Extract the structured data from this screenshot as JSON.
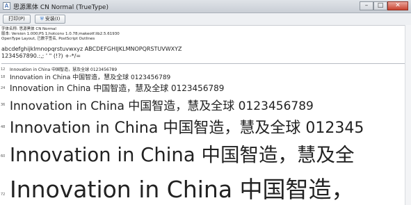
{
  "window": {
    "title": "思源黑体 CN Normal (TrueType)",
    "controls": {
      "minimize": "–",
      "maximize": "□",
      "close": "✕"
    }
  },
  "toolbar": {
    "print_label": "打印(P)",
    "install_label": "安装(I)"
  },
  "font_info": {
    "name_line": "字体名称: 思源黑体 CN Normal",
    "version_line": "版本: Version 1.000;PS 1;hotconv 1.0.78;makeotf.lib2.5.61930",
    "type_line": "OpenType Layout, 已数字签名, PostScript Outlines"
  },
  "charset": {
    "lower_upper": "abcdefghijklmnopqrstuvwxyz ABCDEFGHIJKLMNOPQRSTUVWXYZ",
    "digits_symbols": "1234567890.:,; ' \" (!?) +-*/="
  },
  "samples": [
    {
      "size": "12",
      "text": "Innovation in China 中国智造，慧及全球 0123456789"
    },
    {
      "size": "18",
      "text": "Innovation in China 中国智造，慧及全球 0123456789"
    },
    {
      "size": "24",
      "text": "Innovation in China 中国智造，慧及全球 0123456789"
    },
    {
      "size": "36",
      "text": "Innovation in China 中国智造，慧及全球 0123456789"
    },
    {
      "size": "48",
      "text": "Innovation in China 中国智造，慧及全球 012345"
    },
    {
      "size": "60",
      "text": "Innovation in China 中国智造，慧及全"
    },
    {
      "size": "72",
      "text": "Innovation in China 中国智造，"
    }
  ]
}
